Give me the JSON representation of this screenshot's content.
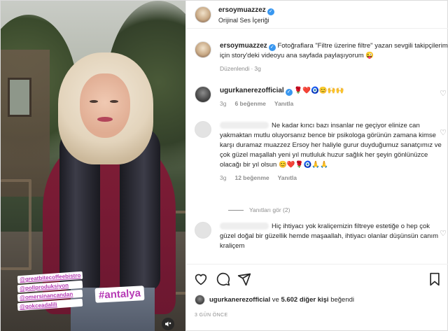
{
  "post": {
    "author": "ersoymuazzez",
    "audio": "Orijinal Ses İçeriği",
    "caption_user": "ersoymuazzez",
    "caption_text": "Fotoğraflara \"Filtre üzerine filtre\" yazan sevgili takipçilerim için story'deki videoyu ana sayfada paylaşıyorum 😜",
    "caption_edited": "Düzenlendi",
    "caption_age": "3g"
  },
  "media": {
    "tags": [
      "@greatbitecoffeebistro",
      "@pollproduksiyon",
      "@omersinancandan",
      "@gokceadalili"
    ],
    "hashtag": "#antalya"
  },
  "comments": [
    {
      "user": "ugurkanerezofficial",
      "text": "🌹❤️🧿😊🙌🙌",
      "age": "3g",
      "likes": "6 beğenme",
      "reply": "Yanıtla"
    },
    {
      "user": "",
      "text": "Ne kadar kıncı bazı insanlar ne geçiyor elinize can yakmaktan mutlu oluyorsanız bence bir psikologa görünün zamana kimse karşı duramaz muazzez Ersoy her haliyle gurur duyduğumuz sanatçımız ve çok güzel maşallah yeni yıl mutluluk huzur sağlık her şeyin gönlünüzce olacağı bir yıl olsun 😊❤️🌹🧿🙏🙏",
      "age": "3g",
      "likes": "12 beğenme",
      "reply": "Yanıtla",
      "replies_label": "Yanıtları gör (2)"
    },
    {
      "user": "",
      "text": "Hiç ihtiyacı yok kraliçemizin filtreye estetiğe o hep çok güzel doğal bir güzellik hemde maşaallah, ihtiyacı olanlar düşünsün canım kraliçem"
    }
  ],
  "likes_bar": {
    "liker": "ugurkanerezofficial",
    "rest": "ve",
    "count_text": "5.602 diğer kişi",
    "suffix": "beğendi"
  },
  "timestamp": "3 GÜN ÖNCE",
  "icons": [
    "heart-icon",
    "comment-icon",
    "share-icon",
    "bookmark-icon",
    "verified-icon",
    "volume-icon"
  ],
  "colors": {
    "verified": "#3897f0",
    "tag": "#b63bb5",
    "muted": "#8e8e8e"
  }
}
